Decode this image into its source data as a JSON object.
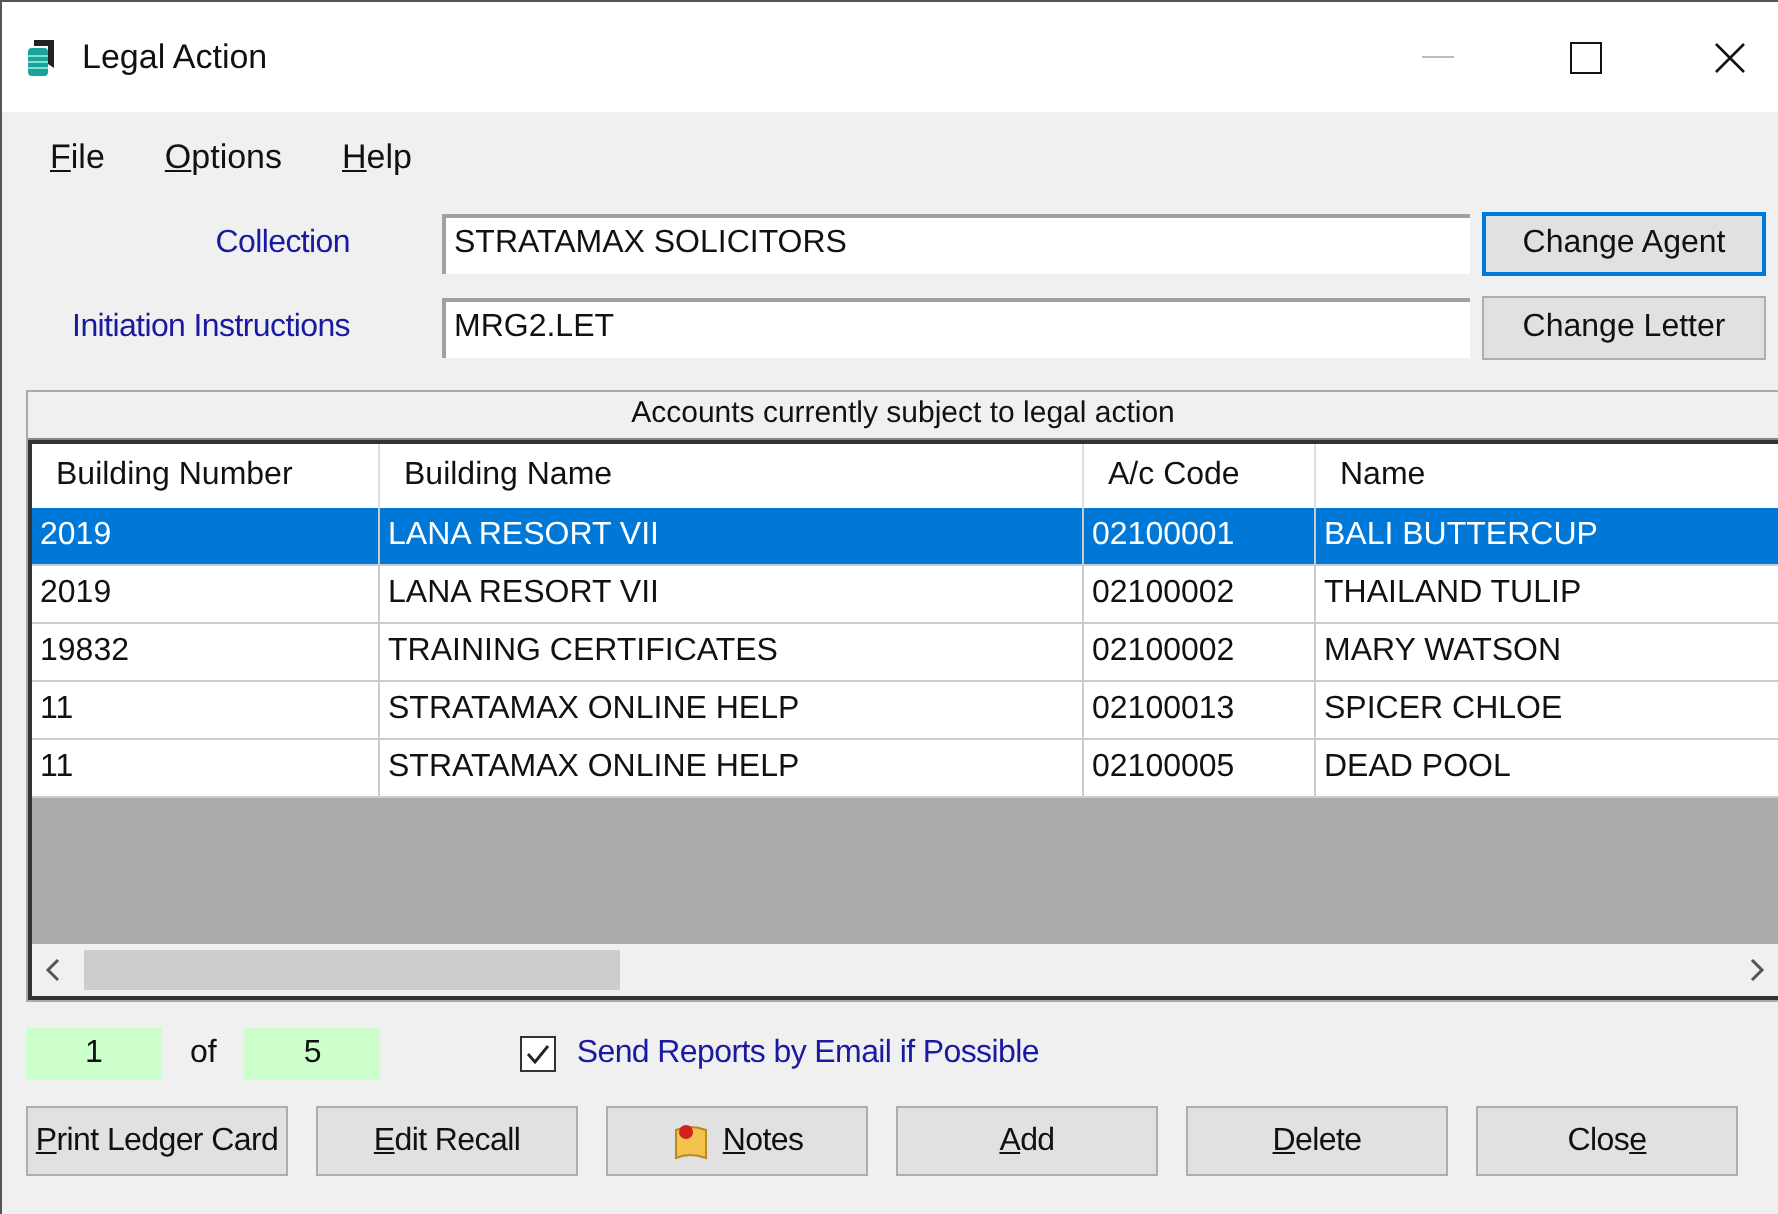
{
  "window": {
    "title": "Legal Action"
  },
  "menu": [
    {
      "label": {
        "key": "F",
        "after": "ile"
      }
    },
    {
      "label": {
        "key": "O",
        "after": "ptions"
      }
    },
    {
      "label": {
        "key": "H",
        "after": "elp"
      }
    }
  ],
  "fields": [
    {
      "label": "Collection",
      "value": "STRATAMAX SOLICITORS",
      "button": "Change Agent",
      "focused": true
    },
    {
      "label": "Initiation Instructions",
      "value": "MRG2.LET",
      "button": "Change Letter",
      "focused": false
    }
  ],
  "table": {
    "caption": "Accounts currently subject to legal action",
    "columns": [
      "Building Number",
      "Building Name",
      "A/c Code",
      "Name"
    ],
    "rows": [
      {
        "cells": [
          "2019",
          "LANA RESORT VII",
          "02100001",
          "BALI BUTTERCUP"
        ],
        "selected": true
      },
      {
        "cells": [
          "2019",
          "LANA RESORT VII",
          "02100002",
          "THAILAND TULIP"
        ],
        "selected": false
      },
      {
        "cells": [
          "19832",
          "TRAINING CERTIFICATES",
          "02100002",
          "MARY WATSON"
        ],
        "selected": false
      },
      {
        "cells": [
          "11",
          "STRATAMAX ONLINE HELP",
          "02100013",
          "SPICER CHLOE"
        ],
        "selected": false
      },
      {
        "cells": [
          "11",
          "STRATAMAX ONLINE HELP",
          "02100005",
          "DEAD POOL"
        ],
        "selected": false
      }
    ]
  },
  "pager": {
    "current": "1",
    "of": "of",
    "total": "5"
  },
  "email_option": {
    "label": "Send Reports by Email if Possible",
    "checked": true
  },
  "buttons": [
    {
      "label": {
        "key": "P",
        "after": "rint Ledger Card"
      },
      "kind": "plain"
    },
    {
      "label": {
        "key": "E",
        "after": "dit Recall"
      },
      "kind": "plain"
    },
    {
      "label": {
        "key": "N",
        "after": "otes"
      },
      "kind": "notes"
    },
    {
      "label": {
        "key": "A",
        "after": "dd"
      },
      "kind": "plain"
    },
    {
      "label": {
        "key": "D",
        "after": "elete"
      },
      "kind": "plain"
    },
    {
      "label": {
        "before": "Clos",
        "key": "e"
      },
      "kind": "plain"
    }
  ]
}
